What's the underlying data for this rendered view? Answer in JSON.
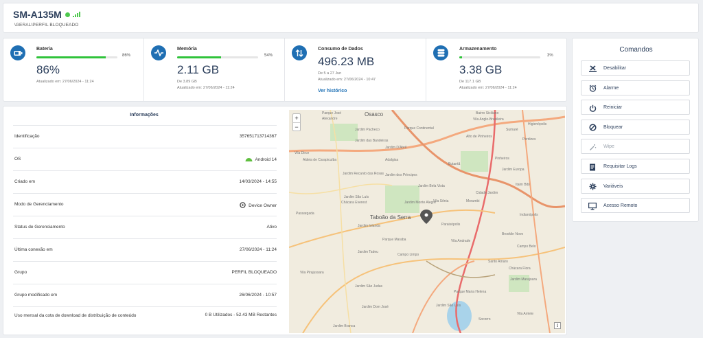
{
  "header": {
    "device_name": "SM-A135M",
    "path": "\\GERAL\\PERFIL BLOQUEADO",
    "status_color": "#4ec94e"
  },
  "stats": {
    "battery": {
      "title": "Bateria",
      "icon": "battery-icon",
      "percent_label": "86%",
      "percent": 86,
      "value": "86%",
      "updated": "Atualizado em: 27/06/2024 - 11:24"
    },
    "memory": {
      "title": "Memória",
      "icon": "pulse-icon",
      "percent_label": "54%",
      "percent": 54,
      "value": "2.11 GB",
      "detail": "De 3.89 GB",
      "updated": "Atualizado em: 27/06/2024 - 11:24"
    },
    "data": {
      "title": "Consumo de Dados",
      "icon": "transfer-arrows-icon",
      "value": "496.23 MB",
      "detail": "De 5 a 27 Jun",
      "updated": "Atualizado em: 27/06/2024 - 10:47",
      "link": "Ver histórico"
    },
    "storage": {
      "title": "Armazenamento",
      "icon": "database-icon",
      "percent_label": "3%",
      "percent": 3,
      "value": "3.38 GB",
      "detail": "De 117.1 GB",
      "updated": "Atualizado em: 27/06/2024 - 11:24"
    }
  },
  "info": {
    "title": "Informações",
    "rows": [
      {
        "label": "Identificação",
        "value": "357651713714367"
      },
      {
        "label": "OS",
        "value": "Android 14",
        "icon": "android-icon"
      },
      {
        "label": "Criado em",
        "value": "14/03/2024 - 14:55"
      },
      {
        "label": "Modo de Gerenciamento",
        "value": "Device Owner",
        "icon": "settings-icon"
      },
      {
        "label": "Status de Gerenciamento",
        "value": "Ativo"
      },
      {
        "label": "Última conexão em",
        "value": "27/06/2024 - 11:24"
      },
      {
        "label": "Grupo",
        "value": "PERFIL BLOQUEADO"
      },
      {
        "label": "Grupo modificado em",
        "value": "26/06/2024 - 10:57"
      },
      {
        "label": "Uso mensal da cota de download de distribuição de conteúdo",
        "value": "0 B Utilizados - 52.43 MB Restantes"
      }
    ]
  },
  "map": {
    "zoom_in": "+",
    "zoom_out": "−",
    "info": "i",
    "labels": [
      "Osasco",
      "Parque José",
      "Alexandre",
      "Jardim Pacheco",
      "Parque Continental",
      "Bairro Siciliano",
      "Vila Anglo-Brasileira",
      "Sumaré",
      "Higienópolis",
      "Jardim das Bandeiras",
      "Jardim D'Abril",
      "Alto de Pinheiros",
      "Perdizes",
      "Vila Dirce",
      "Aldeia de Carapicuíba",
      "Adalgisa",
      "Butantã",
      "Pinheiros",
      "Jardim Europa",
      "Jardim Recanto das Rosas",
      "Jardim dos Príncipes",
      "Jardim Bela Vista",
      "Cidade Jardim",
      "Itaim Bibi",
      "Jardim São Luís",
      "Jardim Monte Alegre",
      "Vila Sônia",
      "Morumbi",
      "Chácara Everest",
      "Taboão da Serra",
      "Paraisópolis",
      "Brooklin Novo",
      "Jardim Iolanda",
      "Vila Andrade",
      "Campo Belo",
      "Parque Maraba",
      "Campo Limpo",
      "Santo Amaro",
      "Jardim Tadeu",
      "Chácara Flora",
      "Jardim Marajoara",
      "Jardim São Judas",
      "Vila Arriete",
      "Jardim São Luís",
      "Jardim Dom José",
      "Socorro",
      "Jardim Branca",
      "Passargada",
      "Vila Pirajussara",
      "Indianópolis",
      "Parque Maria Helena"
    ]
  },
  "commands": {
    "title": "Comandos",
    "items": [
      {
        "label": "Desabilitar",
        "icon": "disable-x-icon",
        "enabled": true
      },
      {
        "label": "Alarme",
        "icon": "alarm-clock-icon",
        "enabled": true
      },
      {
        "label": "Reiniciar",
        "icon": "power-icon",
        "enabled": true
      },
      {
        "label": "Bloquear",
        "icon": "block-icon",
        "enabled": true
      },
      {
        "label": "Wipe",
        "icon": "wand-icon",
        "enabled": false
      },
      {
        "label": "Requisitar Logs",
        "icon": "document-icon",
        "enabled": true
      },
      {
        "label": "Variáveis",
        "icon": "gear-icon",
        "enabled": true
      },
      {
        "label": "Acesso Remoto",
        "icon": "monitor-icon",
        "enabled": true
      }
    ]
  }
}
